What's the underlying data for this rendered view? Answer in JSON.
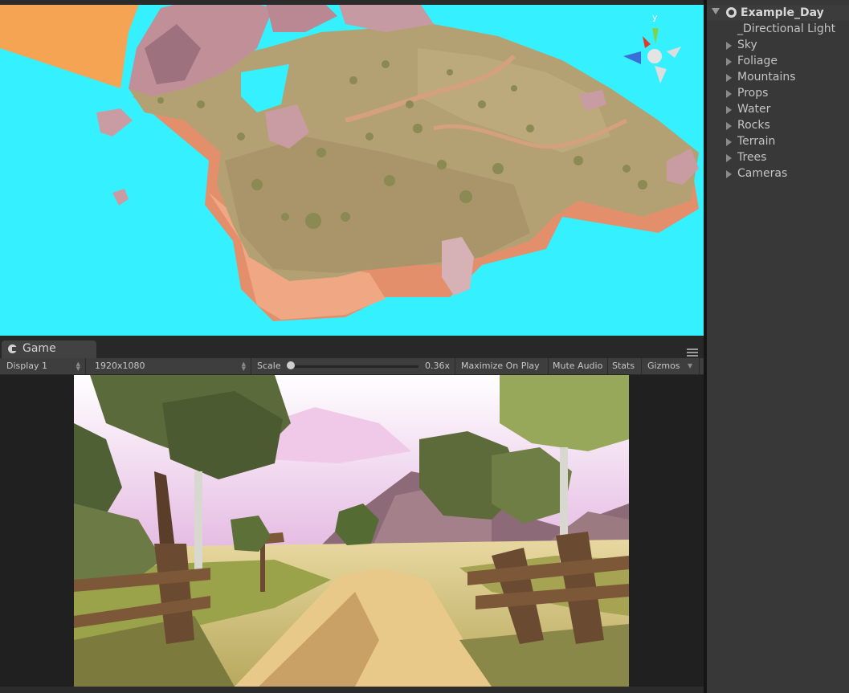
{
  "hierarchy": {
    "scene_name": "Example_Day",
    "items": [
      {
        "label": "_Directional Light",
        "expandable": false
      },
      {
        "label": "Sky",
        "expandable": true
      },
      {
        "label": "Foliage",
        "expandable": true
      },
      {
        "label": "Mountains",
        "expandable": true
      },
      {
        "label": "Props",
        "expandable": true
      },
      {
        "label": "Water",
        "expandable": true
      },
      {
        "label": "Rocks",
        "expandable": true
      },
      {
        "label": "Terrain",
        "expandable": true
      },
      {
        "label": "Trees",
        "expandable": true
      },
      {
        "label": "Cameras",
        "expandable": true
      }
    ]
  },
  "scene_view": {
    "gizmo": {
      "y_label": "y"
    },
    "colors": {
      "water": "#35f0ff",
      "terrain": "#b4a273",
      "cliff": "#e69a7a",
      "rock": "#c49aa4"
    }
  },
  "game": {
    "tab_label": "Game",
    "display": "Display 1",
    "resolution": "1920x1080",
    "scale_label": "Scale",
    "scale_value": "0.36x",
    "scale_fraction": 0.02,
    "maximize_on_play": "Maximize On Play",
    "mute_audio": "Mute Audio",
    "stats": "Stats",
    "gizmos": "Gizmos"
  }
}
